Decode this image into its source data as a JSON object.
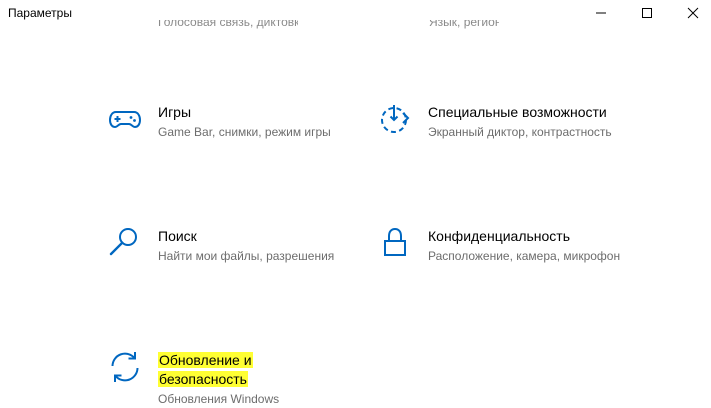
{
  "window": {
    "title": "Параметры",
    "controls": {
      "minimize": "minimize-icon",
      "maximize": "maximize-icon",
      "close": "close-icon"
    }
  },
  "clipped_row": {
    "left_desc": "Голосовая связь, диктовка",
    "right_desc": "Язык, регион"
  },
  "accent_color": "#0067c0",
  "highlight_color": "#ffff33",
  "tiles": [
    {
      "title": "Игры",
      "desc": "Game Bar, снимки, режим игры",
      "icon": "gamepad-icon"
    },
    {
      "title": "Специальные возможности",
      "desc": "Экранный диктор, контрастность",
      "icon": "accessibility-timer-icon"
    },
    {
      "title": "Поиск",
      "desc": "Найти мои файлы, разрешения",
      "icon": "search-icon"
    },
    {
      "title": "Конфиденциальность",
      "desc": "Расположение, камера, микрофон",
      "icon": "lock-icon"
    },
    {
      "title_line1": "Обновление и",
      "title_line2": "безопасность",
      "desc": "Обновления Windows",
      "icon": "refresh-sync-icon"
    }
  ]
}
